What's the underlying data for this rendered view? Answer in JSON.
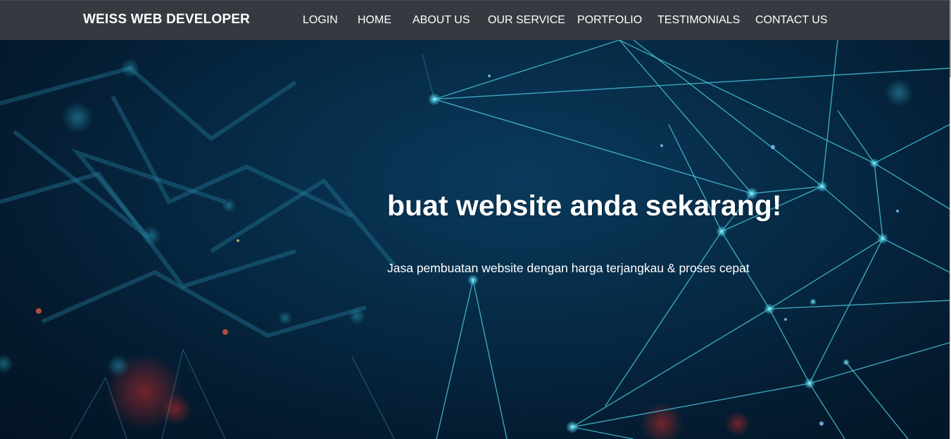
{
  "navbar": {
    "brand": "WEISS WEB DEVELOPER",
    "links": [
      "LOGIN",
      "HOME",
      "ABOUT US",
      "OUR SERVICE",
      "PORTFOLIO",
      "TESTIMONIALS",
      "CONTACT US"
    ]
  },
  "hero": {
    "title": "buat website anda sekarang!",
    "subtitle": "Jasa pembuatan website dengan harga terjangkau & proses cepat"
  },
  "colors": {
    "navbar_bg": "#343a40",
    "hero_bg": "#062a45",
    "network_lines": "#4fd0e8"
  }
}
